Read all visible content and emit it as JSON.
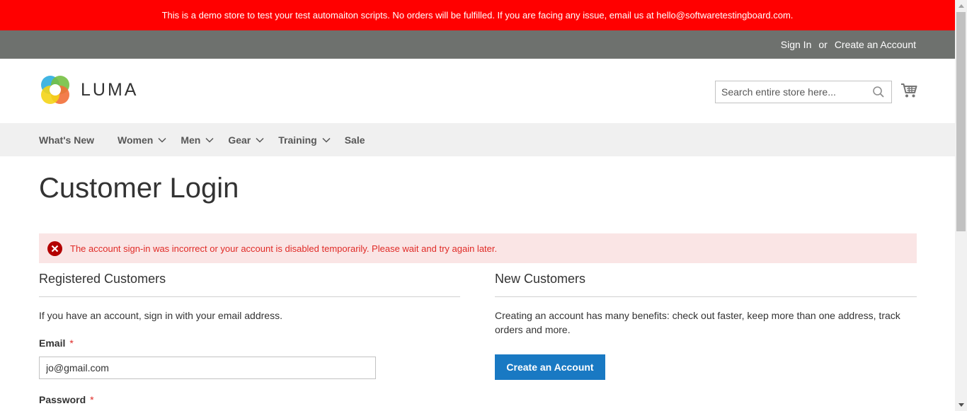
{
  "banner": {
    "text": "This is a demo store to test your test automaiton scripts. No orders will be fulfilled. If you are facing any issue, email us at hello@softwaretestingboard.com."
  },
  "header_panel": {
    "sign_in": "Sign In",
    "or": "or",
    "create_account": "Create an Account"
  },
  "logo": {
    "text": "LUMA"
  },
  "search": {
    "placeholder": "Search entire store here..."
  },
  "nav": {
    "items": [
      {
        "label": "What's New"
      },
      {
        "label": "Women"
      },
      {
        "label": "Men"
      },
      {
        "label": "Gear"
      },
      {
        "label": "Training"
      },
      {
        "label": "Sale"
      }
    ]
  },
  "page": {
    "title": "Customer Login"
  },
  "error": {
    "message": "The account sign-in was incorrect or your account is disabled temporarily. Please wait and try again later."
  },
  "registered": {
    "title": "Registered Customers",
    "intro": "If you have an account, sign in with your email address.",
    "email_label": "Email",
    "email_value": "jo@gmail.com",
    "password_label": "Password",
    "required_mark": "*"
  },
  "new_customers": {
    "title": "New Customers",
    "text": "Creating an account has many benefits: check out faster, keep more than one address, track orders and more.",
    "button_label": "Create an Account"
  },
  "colors": {
    "banner_bg": "#ff0000",
    "panel_bg": "#6e716e",
    "nav_bg": "#f0f0f0",
    "error_bg": "#fae5e5",
    "error_text": "#e02b27",
    "primary_button": "#1979c3"
  },
  "icons": {
    "search": "search-icon",
    "cart": "cart-icon",
    "error": "error-icon",
    "chevron": "chevron-down-icon"
  }
}
